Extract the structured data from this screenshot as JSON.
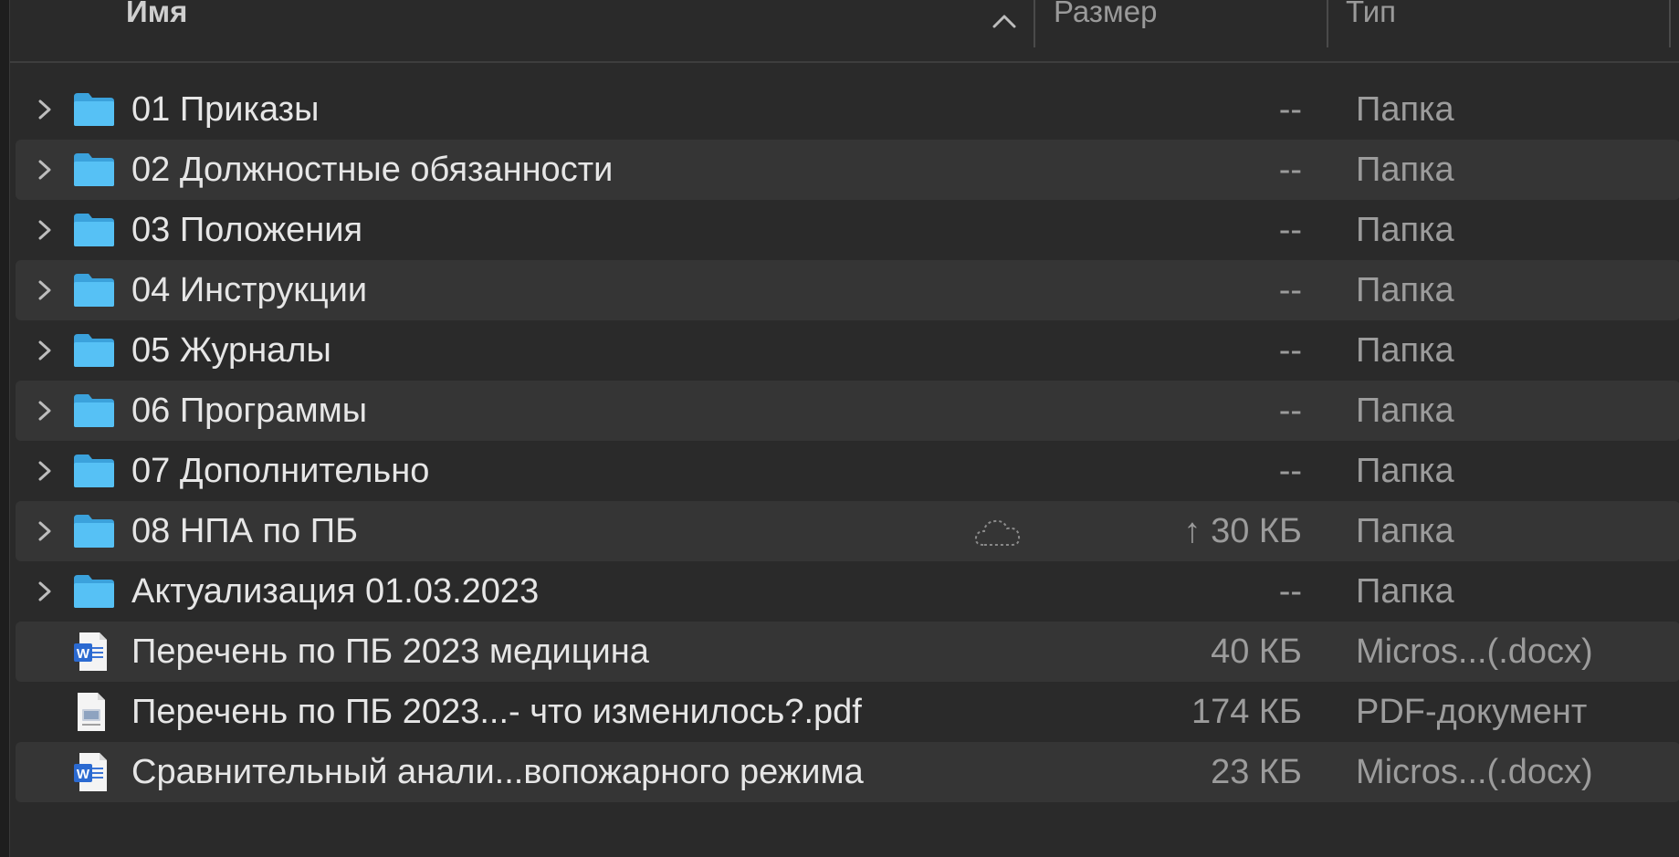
{
  "header": {
    "name_label": "Имя",
    "size_label": "Размер",
    "type_label": "Тип",
    "sort_direction": "ascending"
  },
  "colors": {
    "folder_blue": "#4ab6f0",
    "word_blue": "#2b6ad1",
    "row_alt": "#353535",
    "background": "#2a2a2a"
  },
  "rows": [
    {
      "name": "01 Приказы",
      "size": "--",
      "type": "Папка",
      "kind": "folder"
    },
    {
      "name": "02 Должностные обязанности",
      "size": "--",
      "type": "Папка",
      "kind": "folder"
    },
    {
      "name": "03 Положения",
      "size": "--",
      "type": "Папка",
      "kind": "folder"
    },
    {
      "name": "04 Инструкции",
      "size": "--",
      "type": "Папка",
      "kind": "folder"
    },
    {
      "name": "05 Журналы",
      "size": "--",
      "type": "Папка",
      "kind": "folder"
    },
    {
      "name": "06 Программы",
      "size": "--",
      "type": "Папка",
      "kind": "folder"
    },
    {
      "name": "07 Дополнительно",
      "size": "--",
      "type": "Папка",
      "kind": "folder"
    },
    {
      "name": "08 НПА по ПБ",
      "size": "↑ 30 КБ",
      "type": "Папка",
      "kind": "folder",
      "icloud_status": "cloud-dashed-icon"
    },
    {
      "name": "Актуализация 01.03.2023",
      "size": "--",
      "type": "Папка",
      "kind": "folder"
    },
    {
      "name": "Перечень по ПБ 2023 медицина",
      "size": "40 КБ",
      "type": "Micros...(.docx)",
      "kind": "word-document-icon"
    },
    {
      "name": "Перечень по ПБ 2023...- что изменилось?.pdf",
      "size": "174 КБ",
      "type": "PDF-документ",
      "kind": "pdf-document-icon"
    },
    {
      "name": "Сравнительный анали...вопожарного режима",
      "size": "23 КБ",
      "type": "Micros...(.docx)",
      "kind": "word-document-icon"
    }
  ]
}
